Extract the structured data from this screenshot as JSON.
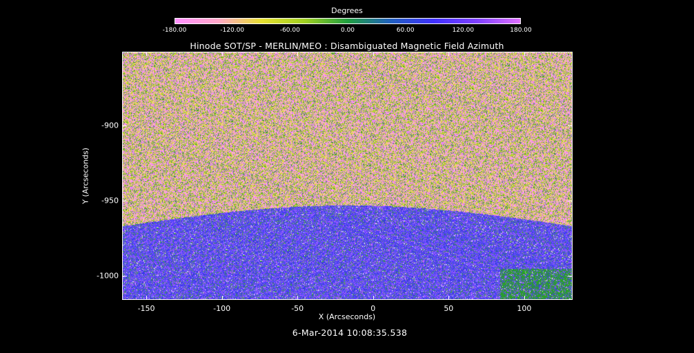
{
  "colorbar": {
    "title": "Degrees",
    "ticks": [
      "-180.00",
      "-120.00",
      "-60.00",
      "0.00",
      "60.00",
      "120.00",
      "180.00"
    ],
    "range": [
      -180,
      180
    ],
    "colors": [
      "#ff90ff",
      "#ffa8c8",
      "#e8e030",
      "#a0d020",
      "#20a040",
      "#2060c0",
      "#4030ff",
      "#8040ff",
      "#e070ff"
    ]
  },
  "plot": {
    "title": "Hinode SOT/SP - MERLIN/MEO : Disambiguated Magnetic Field Azimuth",
    "xlabel": "X (Arcseconds)",
    "ylabel": "Y (Arcseconds)",
    "x_ticks": [
      "-150",
      "-100",
      "-50",
      "0",
      "50",
      "100"
    ],
    "x_tick_values": [
      -150,
      -100,
      -50,
      0,
      50,
      100
    ],
    "y_ticks": [
      "-900",
      "-950",
      "-1000"
    ],
    "y_tick_values": [
      -900,
      -950,
      -1000
    ],
    "xlim": [
      -166,
      132
    ],
    "ylim": [
      -1016,
      -851
    ],
    "limb_y": -964
  },
  "timestamp": "6-Mar-2014 10:08:35.538"
}
